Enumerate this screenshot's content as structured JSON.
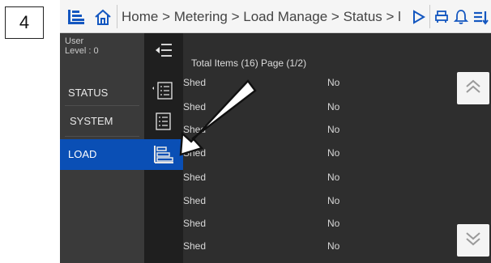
{
  "step_number": "4",
  "topbar": {
    "menu_icon": "menu-lines-icon",
    "home_icon": "home-icon",
    "breadcrumb": "Home > Metering > Load Manage > Status > l",
    "play_icon": "play-icon",
    "print_icon": "printer-icon",
    "bell_icon": "bell-icon",
    "filter_icon": "sort-filter-icon"
  },
  "user": {
    "line1": "User",
    "line2": "Level : 0"
  },
  "nav": {
    "items": [
      {
        "label": "STATUS",
        "selected": false
      },
      {
        "label": "SYSTEM",
        "selected": false
      },
      {
        "label": "LOAD",
        "selected": true
      }
    ]
  },
  "iconcol": {
    "icons": [
      "collapse-menu-icon",
      "list-icon",
      "list-icon",
      "load-bars-icon"
    ]
  },
  "content": {
    "summary": "Total Items (16) Page (1/2)",
    "rows": [
      {
        "name": "Shed",
        "value": "No"
      },
      {
        "name": "Shed",
        "value": "No"
      },
      {
        "name": "Shed",
        "value": "No"
      },
      {
        "name": "Shed",
        "value": "No"
      },
      {
        "name": "Shed",
        "value": "No"
      },
      {
        "name": "Shed",
        "value": "No"
      },
      {
        "name": "Shed",
        "value": "No"
      },
      {
        "name": "Shed",
        "value": "No"
      }
    ],
    "scroll_up_icon": "chevron-double-up-icon",
    "scroll_down_icon": "chevron-double-down-icon"
  },
  "colors": {
    "accent": "#0a4fb5",
    "nav_bg": "#3a3a3a",
    "icon_col_bg": "#1f1f1f",
    "content_bg": "#2e2e2e"
  }
}
